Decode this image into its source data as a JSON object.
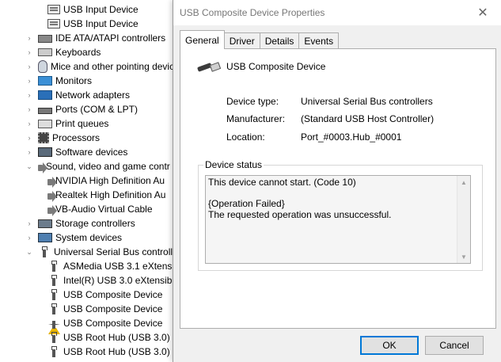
{
  "tree": [
    {
      "label": "USB Input Device",
      "icon": "hid-icon",
      "indent": 1,
      "expander": ""
    },
    {
      "label": "USB Input Device",
      "icon": "hid-icon",
      "indent": 1,
      "expander": ""
    },
    {
      "label": "IDE ATA/ATAPI controllers",
      "icon": "drive-icon",
      "indent": 0,
      "expander": "›"
    },
    {
      "label": "Keyboards",
      "icon": "keyboard-icon",
      "indent": 0,
      "expander": "›"
    },
    {
      "label": "Mice and other pointing devic",
      "icon": "mouse-icon",
      "indent": 0,
      "expander": "›"
    },
    {
      "label": "Monitors",
      "icon": "monitor-icon",
      "indent": 0,
      "expander": "›"
    },
    {
      "label": "Network adapters",
      "icon": "network-icon",
      "indent": 0,
      "expander": "›"
    },
    {
      "label": "Ports (COM & LPT)",
      "icon": "port-icon",
      "indent": 0,
      "expander": "›"
    },
    {
      "label": "Print queues",
      "icon": "printer-icon",
      "indent": 0,
      "expander": "›"
    },
    {
      "label": "Processors",
      "icon": "processor-icon",
      "indent": 0,
      "expander": "›"
    },
    {
      "label": "Software devices",
      "icon": "software-icon",
      "indent": 0,
      "expander": "›"
    },
    {
      "label": "Sound, video and game contr",
      "icon": "sound-icon",
      "indent": 0,
      "expander": "⌄"
    },
    {
      "label": "NVIDIA High Definition Au",
      "icon": "speaker-icon",
      "indent": 1,
      "expander": ""
    },
    {
      "label": "Realtek High Definition Au",
      "icon": "speaker-icon",
      "indent": 1,
      "expander": ""
    },
    {
      "label": "VB-Audio Virtual Cable",
      "icon": "speaker-icon",
      "indent": 1,
      "expander": ""
    },
    {
      "label": "Storage controllers",
      "icon": "storage-icon",
      "indent": 0,
      "expander": "›"
    },
    {
      "label": "System devices",
      "icon": "system-icon",
      "indent": 0,
      "expander": "›"
    },
    {
      "label": "Universal Serial Bus controlle",
      "icon": "usb-icon",
      "indent": 0,
      "expander": "⌄"
    },
    {
      "label": "ASMedia USB 3.1 eXtensib",
      "icon": "usb-icon",
      "indent": 1,
      "expander": ""
    },
    {
      "label": "Intel(R) USB 3.0 eXtensible",
      "icon": "usb-icon",
      "indent": 1,
      "expander": ""
    },
    {
      "label": "USB Composite Device",
      "icon": "usb-icon",
      "indent": 1,
      "expander": ""
    },
    {
      "label": "USB Composite Device",
      "icon": "usb-icon",
      "indent": 1,
      "expander": ""
    },
    {
      "label": "USB Composite Device",
      "icon": "usb-warning-icon",
      "indent": 1,
      "expander": ""
    },
    {
      "label": "USB Root Hub (USB 3.0)",
      "icon": "usb-icon",
      "indent": 1,
      "expander": ""
    },
    {
      "label": "USB Root Hub (USB 3.0)",
      "icon": "usb-icon",
      "indent": 1,
      "expander": ""
    }
  ],
  "dialog": {
    "title": "USB Composite Device Properties",
    "close_glyph": "✕",
    "tabs": [
      {
        "label": "General",
        "active": true
      },
      {
        "label": "Driver",
        "active": false
      },
      {
        "label": "Details",
        "active": false
      },
      {
        "label": "Events",
        "active": false
      }
    ],
    "device_name": "USB Composite Device",
    "properties": [
      {
        "label": "Device type:",
        "value": "Universal Serial Bus controllers"
      },
      {
        "label": "Manufacturer:",
        "value": "(Standard USB Host Controller)"
      },
      {
        "label": "Location:",
        "value": "Port_#0003.Hub_#0001"
      }
    ],
    "status_group_title": "Device status",
    "status_text": "This device cannot start. (Code 10)\n\n{Operation Failed}\nThe requested operation was unsuccessful.",
    "ok_label": "OK",
    "cancel_label": "Cancel"
  }
}
